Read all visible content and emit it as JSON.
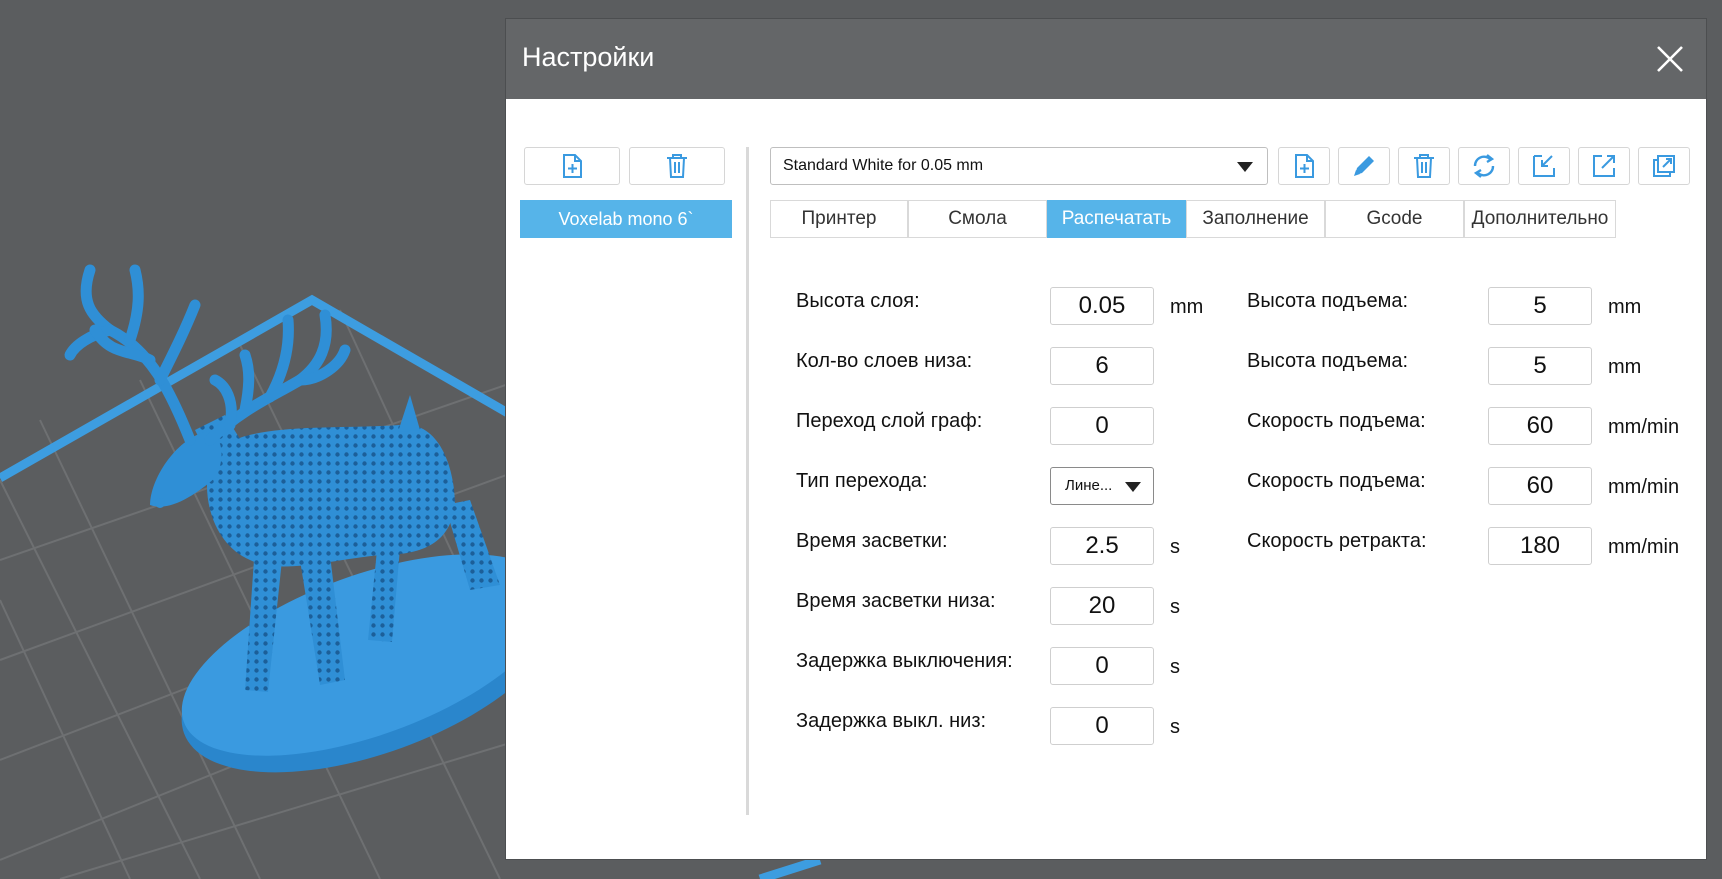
{
  "dialog": {
    "title": "Настройки",
    "close_icon": "close-icon"
  },
  "left_panel": {
    "add_icon": "file-plus-icon",
    "delete_icon": "trash-icon",
    "printers": [
      "Voxelab mono 6`"
    ],
    "selected_printer": "Voxelab mono 6`"
  },
  "profile": {
    "selected": "Standard White for 0.05 mm",
    "toolbar_icons": [
      "file-plus-icon",
      "pencil-icon",
      "trash-icon",
      "refresh-icon",
      "import-icon",
      "export-icon",
      "copy-icon"
    ]
  },
  "tabs": [
    "Принтер",
    "Смола",
    "Распечатать",
    "Заполнение",
    "Gcode",
    "Дополнительно"
  ],
  "active_tab": "Распечатать",
  "fields_left": [
    {
      "label": "Высота слоя:",
      "value": "0.05",
      "unit": "mm"
    },
    {
      "label": "Кол-во слоев низа:",
      "value": "6",
      "unit": ""
    },
    {
      "label": "Переход слой граф:",
      "value": "0",
      "unit": ""
    },
    {
      "label": "Тип перехода:",
      "value": "Лине...",
      "unit": ""
    },
    {
      "label": "Время засветки:",
      "value": "2.5",
      "unit": "s"
    },
    {
      "label": "Время засветки низа:",
      "value": "20",
      "unit": "s"
    },
    {
      "label": "Задержка выключения:",
      "value": "0",
      "unit": "s"
    },
    {
      "label": "Задержка выкл. низ:",
      "value": "0",
      "unit": "s"
    }
  ],
  "fields_right": [
    {
      "label": "Высота подъема:",
      "value": "5",
      "unit": "mm"
    },
    {
      "label": "Высота подъема:",
      "value": "5",
      "unit": "mm"
    },
    {
      "label": "Скорость подъема:",
      "value": "60",
      "unit": "mm/min"
    },
    {
      "label": "Скорость подъема:",
      "value": "60",
      "unit": "mm/min"
    },
    {
      "label": "Скорость ретракта:",
      "value": "180",
      "unit": "mm/min"
    }
  ],
  "colors": {
    "accent": "#56b4e9",
    "model": "#2f8fd6",
    "background": "#5b5d5f",
    "titlebar": "#646668"
  }
}
